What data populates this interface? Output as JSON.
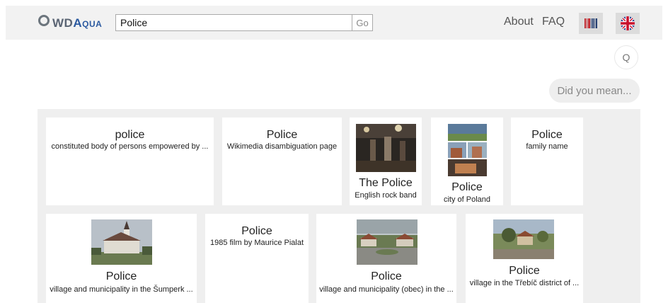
{
  "header": {
    "logo_prefix": "WD",
    "logo_suffix": "Aqua",
    "search_value": "Police",
    "go_label": "Go",
    "about_label": "About",
    "faq_label": "FAQ",
    "barcode_icon": "barcode-icon",
    "flag_icon": "uk-flag-icon"
  },
  "actions": {
    "q_label": "Q",
    "did_you_mean_label": "Did you mean..."
  },
  "results": [
    {
      "title": "police",
      "desc": "constituted body of persons empowered by ..."
    },
    {
      "title": "Police",
      "desc": "Wikimedia disambiguation page"
    },
    {
      "title": "The Police",
      "desc": "English rock band"
    },
    {
      "title": "Police",
      "desc": "city of Poland"
    },
    {
      "title": "Police",
      "desc": "family name"
    },
    {
      "title": "Police",
      "desc": "village and municipality in the Šumperk ..."
    },
    {
      "title": "Police",
      "desc": "1985 film by Maurice Pialat"
    },
    {
      "title": "Police",
      "desc": "village and municipality (obec) in the ..."
    },
    {
      "title": "Police",
      "desc": "village in the Třebíč district of ..."
    }
  ],
  "colors": {
    "topbar": "#f2f2f2",
    "results_bg": "#efefef",
    "logo_accent": "#2c5aa0"
  }
}
